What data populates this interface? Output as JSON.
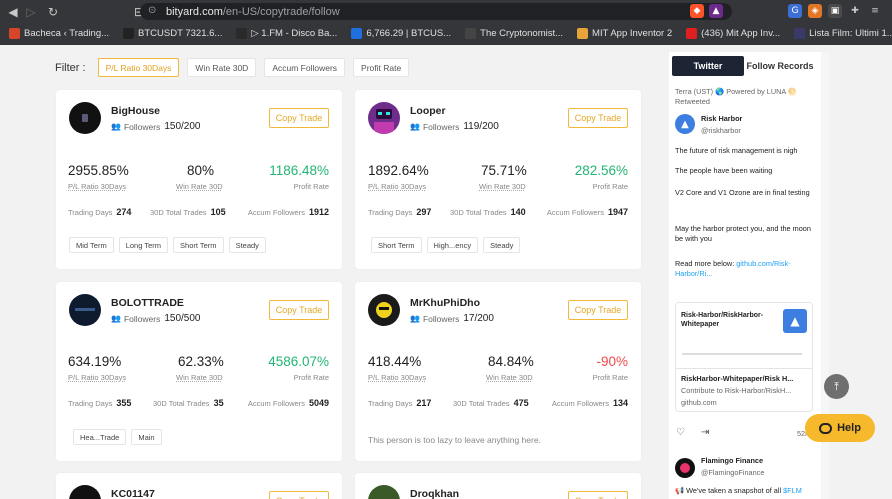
{
  "browser": {
    "url_host": "bityard.com",
    "url_path": "/en-US/copytrade/follow",
    "bookmarks": [
      {
        "label": "Bacheca ‹ Trading...",
        "color": "#d9452b"
      },
      {
        "label": "BTCUSDT 7321.6...",
        "color": "#222222"
      },
      {
        "label": "▷ 1.FM - Disco Ba...",
        "color": "#2a2a2a"
      },
      {
        "label": "6,766.29 | BTCUS...",
        "color": "#1f6fe0"
      },
      {
        "label": "The Cryptonomist...",
        "color": "#444444"
      },
      {
        "label": "MIT App Inventor 2",
        "color": "#e8a33a"
      },
      {
        "label": "(436) Mit App Inv...",
        "color": "#e02020"
      },
      {
        "label": "Lista Film: Ultimi 1...",
        "color": "#3a3a6a"
      }
    ]
  },
  "filter": {
    "label": "Filter :",
    "chips": [
      "P/L Ratio 30Days",
      "Win Rate 30D",
      "Accum Followers",
      "Profit Rate"
    ]
  },
  "common": {
    "copy_label": "Copy Trade",
    "followers_label": "Followers",
    "pl_label": "P/L Ratio 30Days",
    "win_label": "Win Rate 30D",
    "profit_label": "Profit Rate",
    "days_label": "Trading Days",
    "trades_label": "30D Total Trades",
    "accum_label": "Accum Followers"
  },
  "traders": [
    {
      "name": "BigHouse",
      "followers": "150/200",
      "pl": "2955.85%",
      "win": "80%",
      "profit": "1186.48%",
      "profit_color": "green",
      "days": "274",
      "trades": "105",
      "accum": "1912",
      "tags": [
        "Mid Term",
        "Long Term",
        "Short Term",
        "Steady"
      ],
      "note": ""
    },
    {
      "name": "Looper",
      "followers": "119/200",
      "pl": "1892.64%",
      "win": "75.71%",
      "profit": "282.56%",
      "profit_color": "green",
      "days": "297",
      "trades": "140",
      "accum": "1947",
      "tags": [
        "Short Term",
        "High...ency",
        "Steady"
      ],
      "note": ""
    },
    {
      "name": "BOLOTTRADE",
      "followers": "150/500",
      "pl": "634.19%",
      "win": "62.33%",
      "profit": "4586.07%",
      "profit_color": "green",
      "days": "355",
      "trades": "35",
      "accum": "5049",
      "tags": [
        "Hea...Trade",
        "Main"
      ],
      "note": ""
    },
    {
      "name": "MrKhuPhiDho",
      "followers": "17/200",
      "pl": "418.44%",
      "win": "84.84%",
      "profit": "-90%",
      "profit_color": "red",
      "days": "217",
      "trades": "475",
      "accum": "134",
      "tags": [],
      "note": "This person is too lazy to leave anything here."
    },
    {
      "name": "KC01147"
    },
    {
      "name": "Droqkhan"
    }
  ],
  "twitter": {
    "tabs": [
      "Twitter",
      "Follow Records"
    ],
    "retweet_line": "Terra (UST) 🌎 Powered by LUNA 🌕 Retweeted",
    "author_name": "Risk Harbor",
    "author_handle": "@riskharbor",
    "paragraphs": [
      "The future of risk management is nigh",
      "The people have been waiting",
      "V2 Core and V1 Ozone are in final testing",
      "May the harbor protect you, and the moon be with you"
    ],
    "read_more": "Read more below:",
    "read_more_link": "github.com/Risk-Harbor/Ri...",
    "preview_title": "Risk-Harbor/RiskHarbor-Whitepaper",
    "link_title": "RiskHarbor-Whitepaper/Risk H...",
    "link_desc": "Contribute to Risk-Harbor/RiskH...",
    "link_domain": "github.com",
    "time": "52m",
    "next_author": "Flamingo Finance",
    "next_handle": "@FlamingoFinance",
    "next_text_a": "We've taken a snapshot of all",
    "next_text_b": "$FLM"
  },
  "help_label": "Help"
}
